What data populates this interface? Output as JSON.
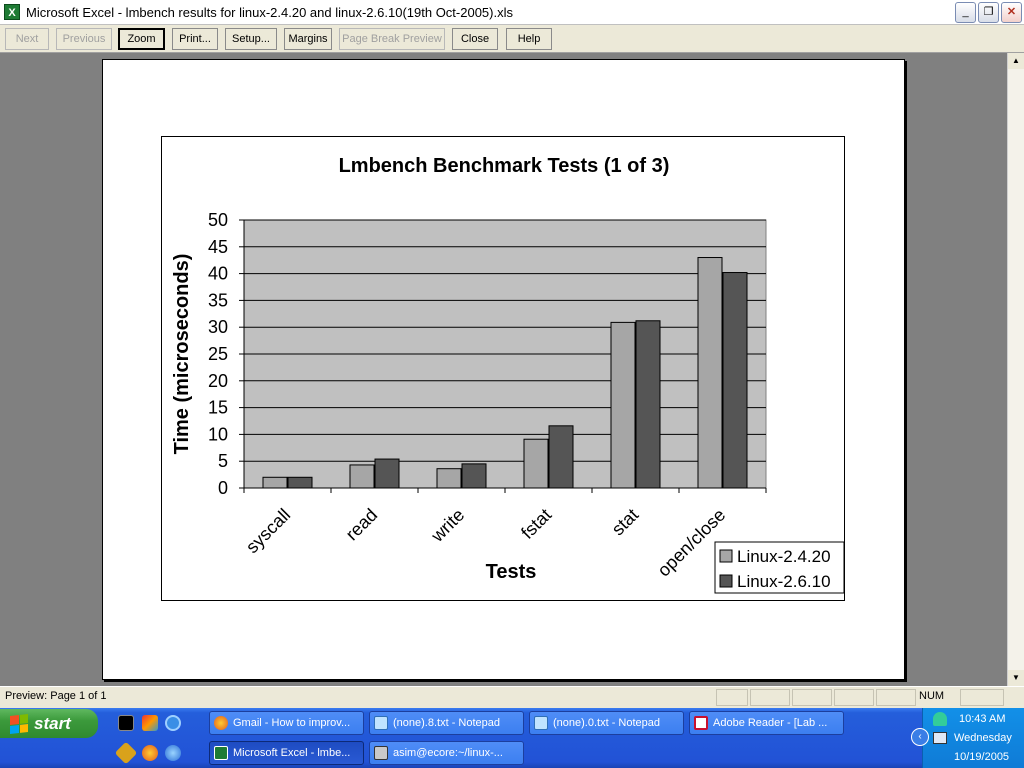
{
  "window": {
    "title": "Microsoft Excel - lmbench results for linux-2.4.20 and linux-2.6.10(19th Oct-2005).xls",
    "app_icon": "excel-icon",
    "controls": {
      "minimize": "_",
      "restore": "❐",
      "close": "✕"
    }
  },
  "toolbar": {
    "buttons": [
      {
        "label": "Next",
        "state": "disabled"
      },
      {
        "label": "Previous",
        "state": "disabled"
      },
      {
        "label": "Zoom",
        "state": "active"
      },
      {
        "label": "Print...",
        "state": "enabled"
      },
      {
        "label": "Setup...",
        "state": "enabled"
      },
      {
        "label": "Margins",
        "state": "enabled"
      },
      {
        "label": "Page Break Preview",
        "state": "disabled"
      },
      {
        "label": "Close",
        "state": "enabled"
      },
      {
        "label": "Help",
        "state": "enabled"
      }
    ]
  },
  "status": {
    "left": "Preview: Page 1 of 1",
    "num": "NUM"
  },
  "taskbar": {
    "start_label": "start",
    "quick_launch": [
      "cmd-icon",
      "paint-icon",
      "ie-icon",
      "winamp-icon",
      "firefox-icon",
      "windows-media-icon"
    ],
    "tasks_row1": [
      {
        "label": "Gmail - How to improv...",
        "icon": "firefox-icon"
      },
      {
        "label": "(none).8.txt - Notepad",
        "icon": "notepad-icon"
      },
      {
        "label": "(none).0.txt - Notepad",
        "icon": "notepad-icon"
      },
      {
        "label": "Adobe Reader - [Lab ...",
        "icon": "adobe-reader-icon"
      }
    ],
    "tasks_row2": [
      {
        "label": "Microsoft Excel - lmbe...",
        "icon": "excel-icon",
        "active": true
      },
      {
        "label": "asim@ecore:~/linux-...",
        "icon": "putty-icon"
      }
    ],
    "tray": {
      "time": "10:43 AM",
      "day": "Wednesday",
      "date": "10/19/2005",
      "icons": [
        "network-user-icon",
        "chevron-left-icon",
        "network-icon"
      ]
    }
  },
  "chart_data": {
    "type": "bar",
    "title": "Lmbench Benchmark Tests (1 of 3)",
    "xlabel": "Tests",
    "ylabel": "Time (microseconds)",
    "ylim": [
      0,
      50
    ],
    "yticks": [
      0,
      5,
      10,
      15,
      20,
      25,
      30,
      35,
      40,
      45,
      50
    ],
    "categories": [
      "syscall",
      "read",
      "write",
      "fstat",
      "stat",
      "open/close"
    ],
    "series": [
      {
        "name": "Linux-2.4.20",
        "color": "#a6a6a6",
        "values": [
          2.0,
          4.3,
          3.6,
          9.1,
          30.9,
          43.0
        ]
      },
      {
        "name": "Linux-2.6.10",
        "color": "#555555",
        "values": [
          2.0,
          5.4,
          4.5,
          11.6,
          31.2,
          40.2
        ]
      }
    ],
    "plot_bg": "#c0c0c0",
    "grid": true,
    "legend_position": "bottom-right"
  }
}
